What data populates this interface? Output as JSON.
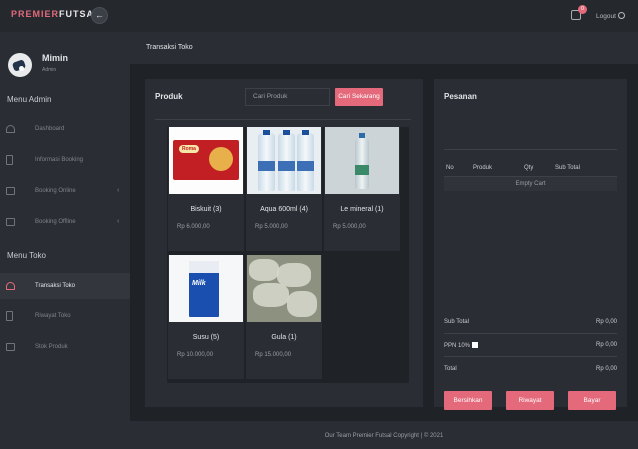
{
  "brand": {
    "part1": "PREMIER",
    "part2": "FUTSAL"
  },
  "topbar": {
    "toggle_icon": "arrow-left-icon",
    "notification_count": "0",
    "logout_label": "Logout"
  },
  "user": {
    "name": "Mimin",
    "role": "Admin"
  },
  "sidebar": {
    "admin_title": "Menu Admin",
    "admin_items": [
      {
        "label": "Dashboard",
        "icon": "dashboard-icon"
      },
      {
        "label": "Informasi Booking",
        "icon": "document-icon"
      },
      {
        "label": "Booking Online",
        "icon": "monitor-icon",
        "chevron": "‹"
      },
      {
        "label": "Booking Offline",
        "icon": "book-icon",
        "chevron": "‹"
      }
    ],
    "toko_title": "Menu Toko",
    "toko_items": [
      {
        "label": "Transaksi Toko",
        "icon": "speedometer-icon",
        "active": true
      },
      {
        "label": "Riwayat Toko",
        "icon": "document-icon"
      },
      {
        "label": "Stok Produk",
        "icon": "box-icon"
      }
    ]
  },
  "page": {
    "title": "Transaksi Toko"
  },
  "products_panel": {
    "title": "Produk",
    "search_placeholder": "Cari Produk",
    "search_button": "Cari Sekarang",
    "items": [
      {
        "name": "Biskuit (3)",
        "price": "Rp 6.000,00"
      },
      {
        "name": "Aqua 600ml (4)",
        "price": "Rp 5.000,00"
      },
      {
        "name": "Le mineral (1)",
        "price": "Rp 5.000,00"
      },
      {
        "name": "Susu (5)",
        "price": "Rp 10.000,00"
      },
      {
        "name": "Gula (1)",
        "price": "Rp 15.000,00"
      }
    ],
    "image_text": {
      "biskuit": "Roma",
      "susu": "Milk"
    }
  },
  "order_panel": {
    "title": "Pesanan",
    "columns": [
      "No",
      "Produk",
      "Qty",
      "Sub Total"
    ],
    "empty_text": "Empty Cart",
    "subtotal_label": "Sub Total",
    "subtotal_value": "Rp 0,00",
    "ppn_label": "PPN 10%",
    "ppn_value": "Rp 0,00",
    "total_label": "Total",
    "total_value": "Rp 0,00",
    "buttons": {
      "clear": "Bersihkan",
      "history": "Riwayat",
      "pay": "Bayar"
    }
  },
  "footer": {
    "text": "Our Team Premier Futsal Copyright | © 2021"
  },
  "colors": {
    "accent": "#e46a7b",
    "background": "#1f2226",
    "panel": "#2a2d33"
  }
}
